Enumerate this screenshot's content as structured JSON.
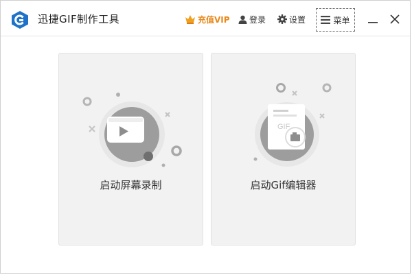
{
  "app": {
    "title": "迅捷GIF制作工具",
    "logo_icon": "app-logo-icon"
  },
  "toolbar": {
    "vip_label": "充值VIP",
    "vip_icon": "crown-icon",
    "login_label": "登录",
    "login_icon": "user-icon",
    "settings_label": "设置",
    "settings_icon": "gear-icon",
    "menu_label": "菜单",
    "menu_icon": "hamburger-icon"
  },
  "window_controls": {
    "minimize_icon": "minimize-icon",
    "close_icon": "close-icon"
  },
  "cards": [
    {
      "label": "启动屏幕录制",
      "icon": "video-play-icon"
    },
    {
      "label": "启动Gif编辑器",
      "icon": "gif-document-icon"
    }
  ],
  "colors": {
    "accent": "#1e73c8",
    "vip": "#e8891b",
    "card_bg": "#f2f2f2",
    "illustration_gray": "#9a9a9a"
  }
}
